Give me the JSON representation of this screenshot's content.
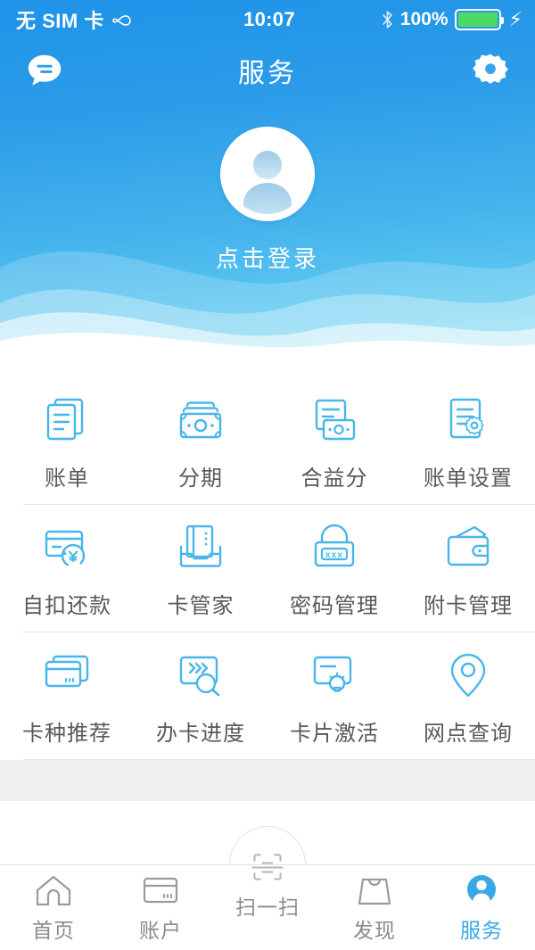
{
  "status_bar": {
    "carrier": "无 SIM 卡",
    "loop_icon": "loop-icon",
    "time": "10:07",
    "bluetooth_icon": "bluetooth-icon",
    "battery_percent": "100%",
    "battery_level": 100,
    "charging_icon": "lightning-bolt-icon"
  },
  "header": {
    "title": "服务",
    "left_icon": "chat-bubble-icon",
    "right_icon": "gear-icon",
    "gradient_top": "#1e93e8",
    "gradient_bottom": "#7ddaf4"
  },
  "profile": {
    "avatar_icon": "user-avatar-icon",
    "login_label": "点击登录"
  },
  "grid": {
    "rows": [
      [
        {
          "label": "账单",
          "icon": "document-stack-icon"
        },
        {
          "label": "分期",
          "icon": "banknote-stack-icon"
        },
        {
          "label": "合益分",
          "icon": "bill-money-icon"
        },
        {
          "label": "账单设置",
          "icon": "document-gear-icon"
        }
      ],
      [
        {
          "label": "自扣还款",
          "icon": "card-yen-refresh-icon"
        },
        {
          "label": "卡管家",
          "icon": "card-folder-icon"
        },
        {
          "label": "密码管理",
          "icon": "padlock-password-icon"
        },
        {
          "label": "附卡管理",
          "icon": "wallet-icon"
        }
      ],
      [
        {
          "label": "卡种推荐",
          "icon": "card-stack-icon"
        },
        {
          "label": "办卡进度",
          "icon": "card-search-icon"
        },
        {
          "label": "卡片激活",
          "icon": "card-lightbulb-icon"
        },
        {
          "label": "网点查询",
          "icon": "location-pin-icon"
        }
      ]
    ],
    "icon_color": "#49b6ea",
    "label_color": "#595959"
  },
  "tabbar": {
    "active_color": "#3ca7e8",
    "inactive_color": "#8b8b8b",
    "items": [
      {
        "label": "首页",
        "icon": "home-icon",
        "active": false
      },
      {
        "label": "账户",
        "icon": "credit-card-icon",
        "active": false
      },
      {
        "label": "扫一扫",
        "icon": "scan-qr-icon",
        "active": false
      },
      {
        "label": "发现",
        "icon": "shopping-bag-icon",
        "active": false
      },
      {
        "label": "服务",
        "icon": "user-circle-icon",
        "active": true
      }
    ]
  }
}
